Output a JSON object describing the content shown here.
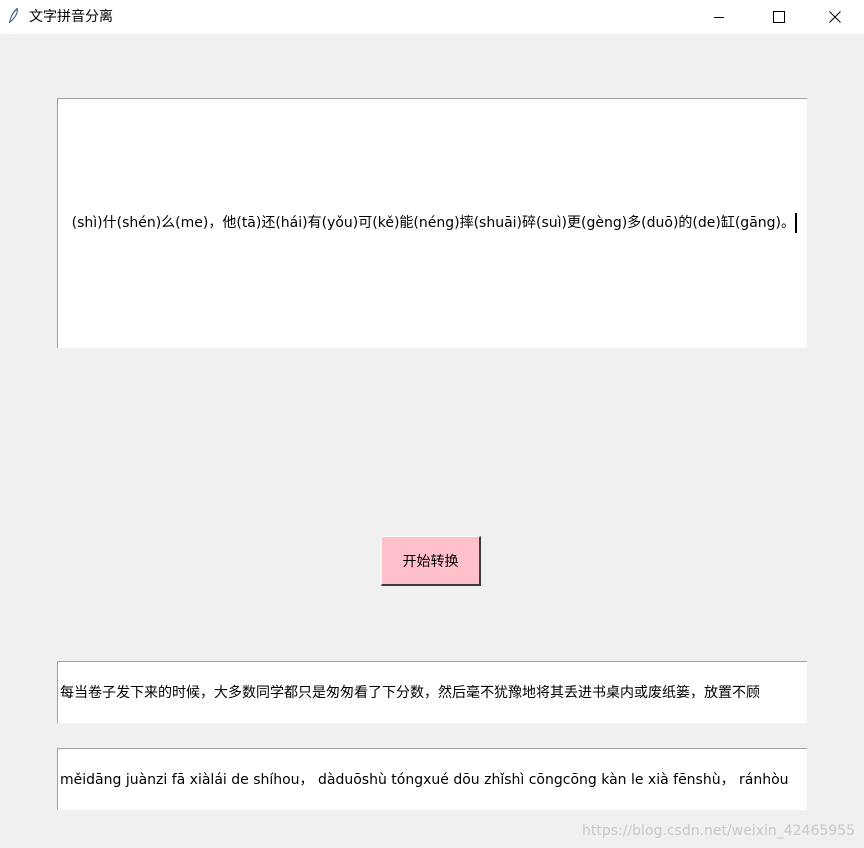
{
  "window": {
    "title": "文字拼音分离",
    "icon": "feather-icon",
    "controls": [
      "minimize-icon",
      "maximize-icon",
      "close-icon"
    ]
  },
  "input_text": {
    "visible_text": "(shì)什(shén)么(me)，他(tā)还(hái)有(yǒu)可(kě)能(néng)摔(shuāi)碎(suì)更(gèng)多(duō)的(de)缸(gāng)。"
  },
  "convert_button": {
    "label": "开始转换",
    "background": "#ffc0cb"
  },
  "output_chinese": {
    "value": "每当卷子发下来的时候，大多数同学都只是匆匆看了下分数，然后毫不犹豫地将其丢进书桌内或废纸篓，放置不顾"
  },
  "output_pinyin": {
    "value": "měidāng juànzi fā xiàlái de shíhou， dàduōshù tóngxué dōu zhǐshì cōngcōng kàn le xià fēnshù， ránhòu"
  },
  "watermark": {
    "text": "https://blog.csdn.net/weixin_42465955"
  },
  "colors": {
    "background": "#f0f0f0",
    "field_background": "#ffffff",
    "field_border": "#a0a0a0"
  }
}
